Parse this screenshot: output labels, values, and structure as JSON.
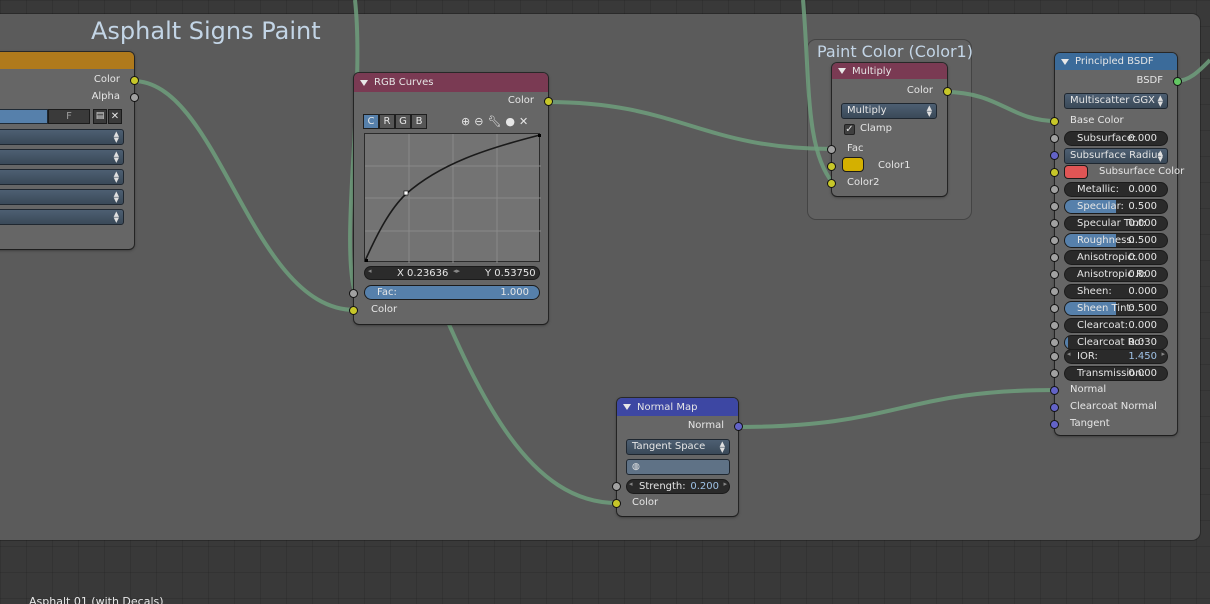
{
  "frames": {
    "main": {
      "label": "Asphalt Signs Paint"
    },
    "paint": {
      "label": "Paint Color (Color1)"
    }
  },
  "image_texture": {
    "outputs": [
      "Color",
      "Alpha"
    ],
    "file_letter": "F"
  },
  "rgb_curves": {
    "title": "RGB Curves",
    "output": "Color",
    "channels": [
      "C",
      "R",
      "G",
      "B"
    ],
    "active_channel": "C",
    "point_x": "X 0.23636",
    "point_y": "Y 0.53750",
    "fac_label": "Fac:",
    "fac_value": "1.000",
    "fac": 1.0,
    "input": "Color"
  },
  "multiply": {
    "title": "Multiply",
    "output": "Color",
    "blend_mode": "Multiply",
    "clamp_label": "Clamp",
    "clamp": true,
    "fac_label": "Fac",
    "color1_label": "Color1",
    "color1": "#d4b000",
    "color2_label": "Color2"
  },
  "bsdf": {
    "title": "Principled BSDF",
    "output": "BSDF",
    "distribution": "Multiscatter GGX",
    "base_color_label": "Base Color",
    "subsurface_label": "Subsurface:",
    "subsurface_value": "0.000",
    "subsurface_method": "Subsurface Radius",
    "subsurface_color_label": "Subsurface Color",
    "subsurface_color": "#e05555",
    "sliders": [
      {
        "label": "Metallic:",
        "value": "0.000",
        "fill": 0.0
      },
      {
        "label": "Specular:",
        "value": "0.500",
        "fill": 0.5
      },
      {
        "label": "Specular Tint:",
        "value": "0.000",
        "fill": 0.0
      },
      {
        "label": "Roughness:",
        "value": "0.500",
        "fill": 0.5
      },
      {
        "label": "Anisotropic:",
        "value": "0.000",
        "fill": 0.0
      },
      {
        "label": "Anisotropic R:",
        "value": "0.000",
        "fill": 0.0
      },
      {
        "label": "Sheen:",
        "value": "0.000",
        "fill": 0.0
      },
      {
        "label": "Sheen Tint:",
        "value": "0.500",
        "fill": 0.5
      },
      {
        "label": "Clearcoat:",
        "value": "0.000",
        "fill": 0.0
      },
      {
        "label": "Clearcoat Ro:",
        "value": "0.030",
        "fill": 0.03
      }
    ],
    "ior_label": "IOR:",
    "ior_value": "1.450",
    "transmission_label": "Transmission:",
    "transmission_value": "0.000",
    "normal_label": "Normal",
    "clearcoat_normal_label": "Clearcoat Normal",
    "tangent_label": "Tangent"
  },
  "normal_map": {
    "title": "Normal Map",
    "output": "Normal",
    "space": "Tangent Space",
    "strength_label": "Strength:",
    "strength_value": "0.200",
    "input": "Color"
  },
  "status": {
    "material_label": "Asphalt 01 (with Decals)"
  },
  "colors": {
    "link": "#6f9f7d",
    "socket_color": "#c7c729",
    "socket_vector": "#6363c7",
    "socket_float": "#a1a1a1",
    "socket_shader": "#63c763"
  }
}
